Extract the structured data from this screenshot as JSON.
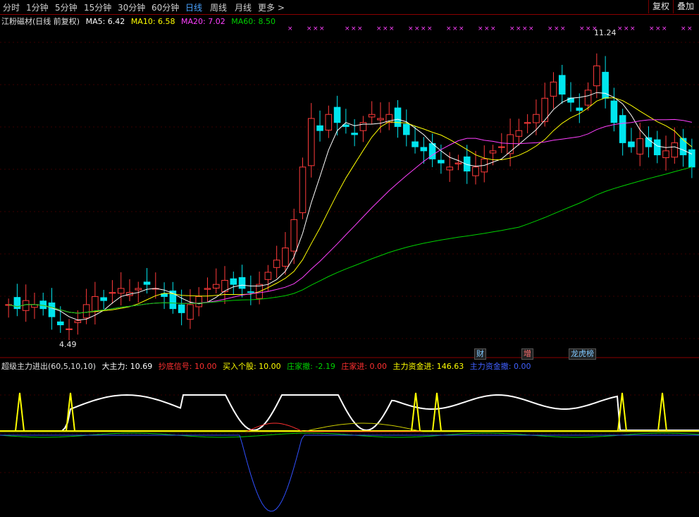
{
  "toolbar": {
    "periods": [
      {
        "label": "分时",
        "active": false
      },
      {
        "label": "1分钟",
        "active": false
      },
      {
        "label": "5分钟",
        "active": false
      },
      {
        "label": "15分钟",
        "active": false
      },
      {
        "label": "30分钟",
        "active": false
      },
      {
        "label": "60分钟",
        "active": false
      },
      {
        "label": "日线",
        "active": true
      },
      {
        "label": "周线",
        "active": false
      },
      {
        "label": "月线",
        "active": false
      }
    ],
    "more_label": "更多 >",
    "fuquan_label": "复权",
    "diejia_label": "叠加"
  },
  "main_legend": {
    "title": "江粉磁材(日线 前复权)",
    "ma5": "MA5: 6.42",
    "ma10": "MA10: 6.58",
    "ma20": "MA20: 7.02",
    "ma60": "MA60: 8.50",
    "colors": {
      "ma5": "#ffffff",
      "ma10": "#ffff00",
      "ma20": "#ff40ff",
      "ma60": "#00d000"
    }
  },
  "price_labels": {
    "high": "11.24",
    "low": "4.49"
  },
  "event_markers": [
    {
      "label": "财",
      "color": "#7ec8ff"
    },
    {
      "label": "增",
      "color": "#ff7070"
    },
    {
      "label": "龙虎榜",
      "color": "#7ec8ff"
    }
  ],
  "indicator_legend": {
    "title": "超级主力进出(60,5,10,10)",
    "da_zhu_li": "大主力: 10.69",
    "chao_di": "抄底信号: 10.00",
    "mai_ru": "买入个股: 10.00",
    "zhuang_san": "庄家撤: -2.19",
    "zhuang_jin": "庄家进: 0.00",
    "zijin_jin": "主力资金进: 146.63",
    "zijin_san": "主力资金撤: 0.00"
  },
  "chart_data": {
    "type": "candlestick",
    "approx_closes": [
      5.1,
      5.0,
      5.2,
      5.1,
      5.0,
      4.8,
      4.6,
      4.5,
      4.7,
      5.1,
      5.3,
      5.2,
      5.4,
      5.5,
      5.4,
      5.5,
      5.6,
      5.5,
      5.3,
      5.0,
      4.9,
      5.1,
      5.3,
      5.5,
      5.6,
      5.7,
      5.6,
      5.5,
      5.4,
      5.6,
      5.9,
      6.2,
      6.5,
      7.2,
      8.5,
      9.7,
      9.4,
      9.8,
      9.6,
      9.5,
      9.3,
      9.6,
      9.8,
      9.7,
      9.8,
      9.5,
      9.3,
      9.0,
      8.9,
      8.7,
      8.6,
      8.5,
      8.6,
      8.4,
      8.5,
      8.7,
      8.9,
      9.0,
      9.3,
      9.4,
      9.6,
      9.8,
      10.2,
      10.6,
      10.3,
      10.1,
      9.9,
      10.4,
      11.0,
      10.2,
      9.6,
      9.1,
      9.0,
      9.2,
      9.0,
      8.8,
      8.9,
      9.1,
      8.8,
      8.5
    ],
    "price_range": [
      4.0,
      12.0
    ],
    "indicator_series": [
      "大主力",
      "抄底信号",
      "买入个股",
      "庄家撤",
      "庄家进",
      "主力资金进",
      "主力资金撤"
    ]
  }
}
